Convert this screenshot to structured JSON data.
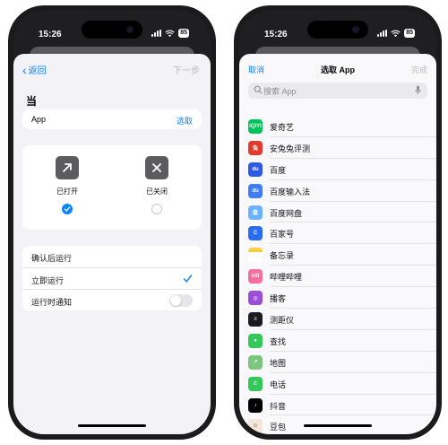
{
  "left": {
    "status": {
      "time": "15:26",
      "battery": "85"
    },
    "nav": {
      "back_label": "返回",
      "next_label": "下一步"
    },
    "title": "当",
    "app_row": {
      "label": "App",
      "action": "选取"
    },
    "options": [
      {
        "label": "已打开",
        "icon": "arrow-up-right-icon",
        "selected": true
      },
      {
        "label": "已关闭",
        "icon": "x-mark-icon",
        "selected": false
      }
    ],
    "run": {
      "header": "确认后运行",
      "immediate": "立即运行",
      "notify": "运行时通知"
    }
  },
  "right": {
    "status": {
      "time": "15:26",
      "battery": "85"
    },
    "nav": {
      "cancel_label": "取消",
      "title": "选取 App",
      "done_label": "完成"
    },
    "search": {
      "placeholder": "搜索 App"
    },
    "apps": [
      {
        "name": "爱奇艺",
        "color": "#00c15a",
        "glyph": "iQIYI"
      },
      {
        "name": "安兔兔评测",
        "color": "#e23a2d",
        "glyph": "兔"
      },
      {
        "name": "百度",
        "color": "#2e5be5",
        "glyph": "du"
      },
      {
        "name": "百度输入法",
        "color": "#3d7df6",
        "glyph": "du"
      },
      {
        "name": "百度网盘",
        "color": "#6ab3ff",
        "glyph": "盘"
      },
      {
        "name": "百家号",
        "color": "#2a6cf0",
        "glyph": "C"
      },
      {
        "name": "备忘录",
        "color": "#f7cf3f",
        "glyph": ""
      },
      {
        "name": "哔哩哔哩",
        "color": "#f56f9b",
        "glyph": "bili"
      },
      {
        "name": "播客",
        "color": "#9b4fd6",
        "glyph": "◎"
      },
      {
        "name": "测距仪",
        "color": "#1c1c1e",
        "glyph": "≡"
      },
      {
        "name": "查找",
        "color": "#34c759",
        "glyph": "●"
      },
      {
        "name": "地图",
        "color": "#7dc67e",
        "glyph": "↗"
      },
      {
        "name": "电话",
        "color": "#34c759",
        "glyph": "✆"
      },
      {
        "name": "抖音",
        "color": "#000000",
        "glyph": "♪"
      },
      {
        "name": "豆包",
        "color": "#f4e6d8",
        "glyph": "☺"
      }
    ]
  },
  "colors": {
    "accent": "#0a84ff",
    "frame": "#1b1b1d"
  }
}
